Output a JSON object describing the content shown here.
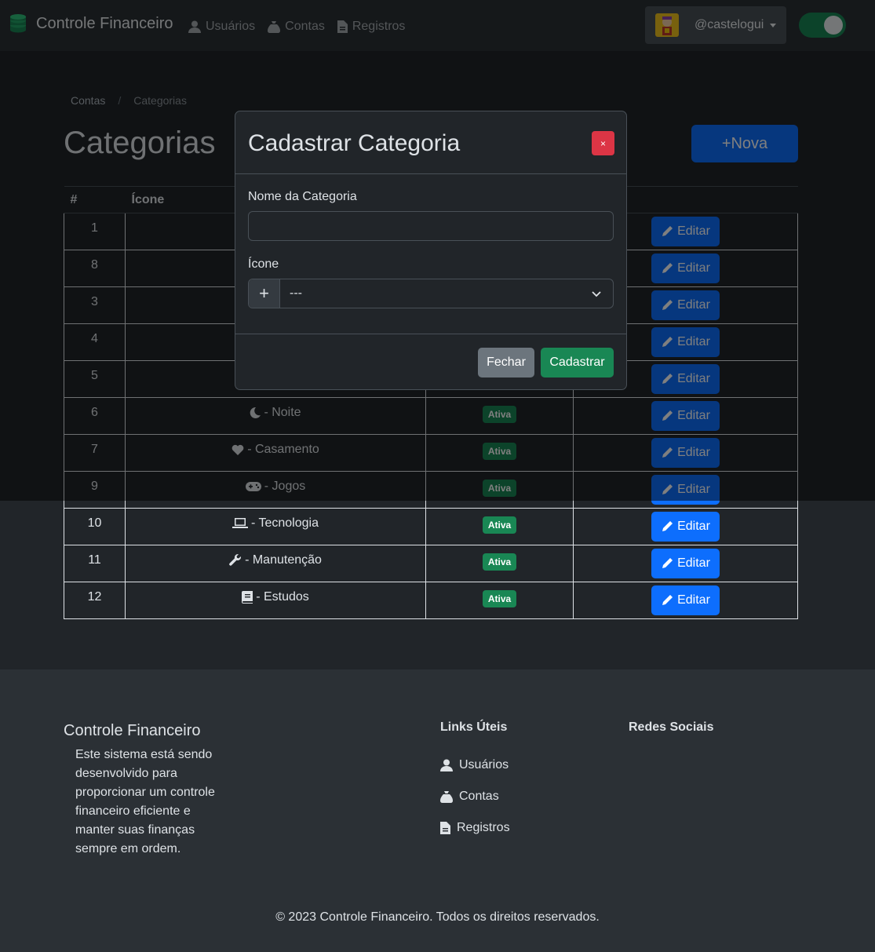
{
  "navbar": {
    "brand": "Controle Financeiro",
    "links": [
      {
        "label": "Usuários",
        "icon": "user-icon"
      },
      {
        "label": "Contas",
        "icon": "money-bag-icon"
      },
      {
        "label": "Registros",
        "icon": "invoice-icon"
      }
    ],
    "username": "@castelogui",
    "theme_toggle_on": true
  },
  "breadcrumb": [
    "Contas",
    "Categorias"
  ],
  "page_title": "Categorias",
  "new_button": "+Nova",
  "table": {
    "headers": [
      "#",
      "Ícone",
      "",
      ""
    ],
    "rows": [
      {
        "id": "1",
        "icon": "",
        "label": "",
        "status": "",
        "action": "Editar"
      },
      {
        "id": "8",
        "icon": "",
        "label": "",
        "status": "",
        "action": "Editar"
      },
      {
        "id": "3",
        "icon": "",
        "label": "",
        "status": "",
        "action": "Editar"
      },
      {
        "id": "4",
        "icon": "",
        "label": "",
        "status": "",
        "action": "Editar"
      },
      {
        "id": "5",
        "icon": "",
        "label": "",
        "status": "",
        "action": "Editar"
      },
      {
        "id": "6",
        "icon": "moon-icon",
        "label": "- Noite",
        "status": "Ativa",
        "action": "Editar"
      },
      {
        "id": "7",
        "icon": "heart-icon",
        "label": "- Casamento",
        "status": "Ativa",
        "action": "Editar"
      },
      {
        "id": "9",
        "icon": "gamepad-icon",
        "label": "- Jogos",
        "status": "Ativa",
        "action": "Editar"
      },
      {
        "id": "10",
        "icon": "laptop-icon",
        "label": "- Tecnologia",
        "status": "Ativa",
        "action": "Editar"
      },
      {
        "id": "11",
        "icon": "wrench-icon",
        "label": "- Manutenção",
        "status": "Ativa",
        "action": "Editar"
      },
      {
        "id": "12",
        "icon": "book-icon",
        "label": "- Estudos",
        "status": "Ativa",
        "action": "Editar"
      }
    ]
  },
  "footer": {
    "title": "Controle Financeiro",
    "description": "Este sistema está sendo desenvolvido para proporcionar um controle financeiro eficiente e manter suas finanças sempre em ordem.",
    "links_heading": "Links Úteis",
    "links": [
      {
        "label": "Usuários",
        "icon": "user-icon"
      },
      {
        "label": "Contas",
        "icon": "money-bag-icon"
      },
      {
        "label": "Registros",
        "icon": "invoice-icon"
      }
    ],
    "social_heading": "Redes Sociais",
    "copyright": "© 2023 Controle Financeiro. Todos os direitos reservados."
  },
  "modal": {
    "title": "Cadastrar Categoria",
    "close_label": "×",
    "name_label": "Nome da Categoria",
    "name_value": "",
    "icon_label": "Ícone",
    "icon_add": "+",
    "icon_select_value": "---",
    "cancel_button": "Fechar",
    "submit_button": "Cadastrar"
  },
  "colors": {
    "primary": "#0d6efd",
    "success": "#198754",
    "danger": "#dc3545",
    "secondary": "#6c757d",
    "background": "#212529",
    "navbar": "#2b3035"
  }
}
